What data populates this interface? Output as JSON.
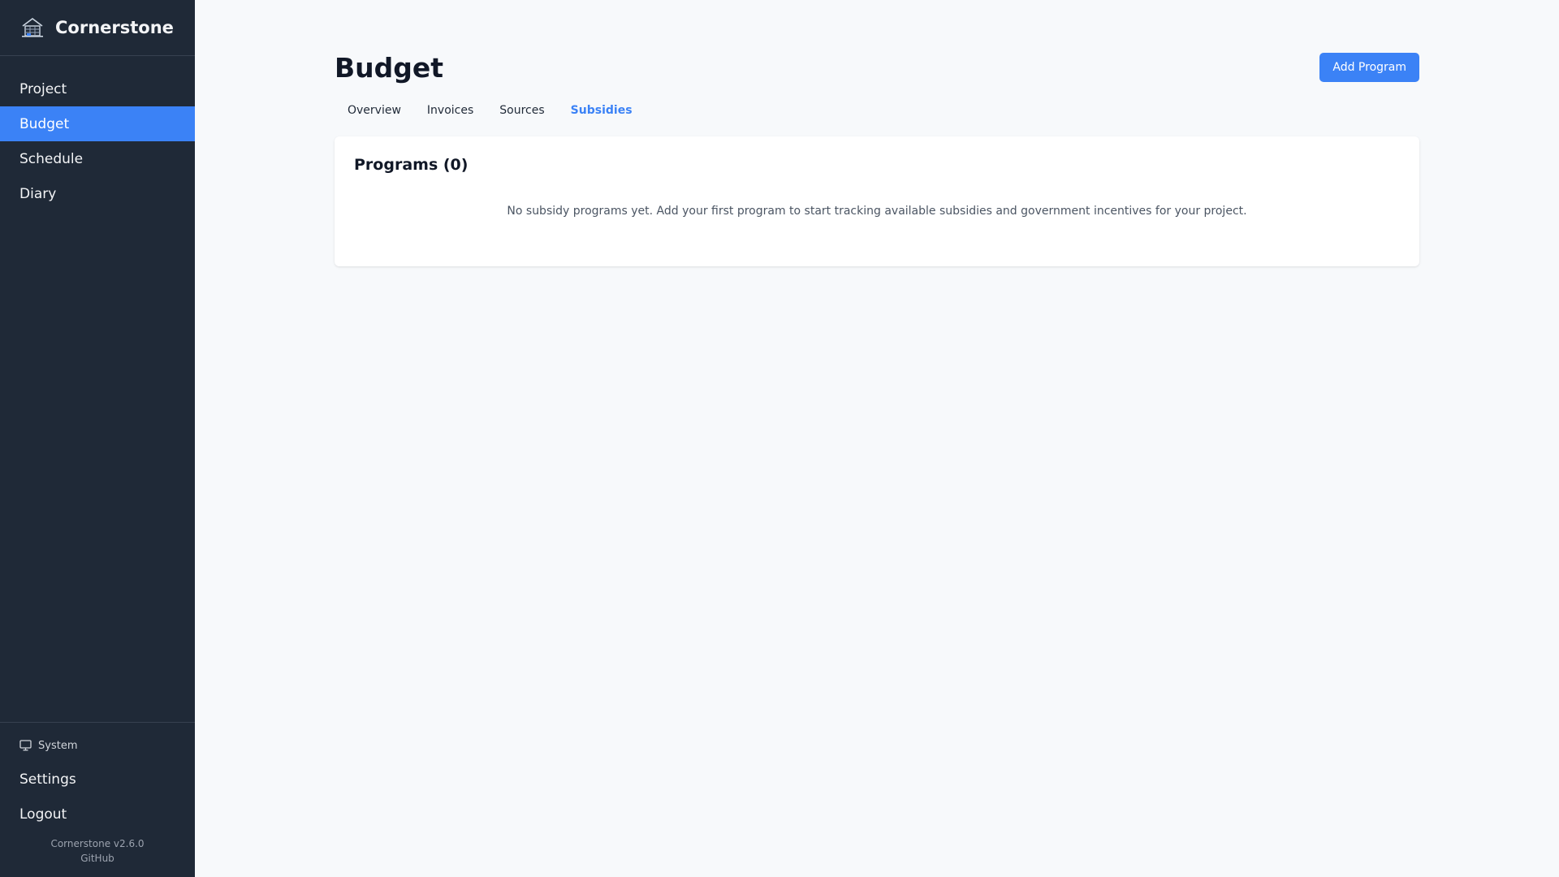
{
  "app": {
    "name": "Cornerstone",
    "logo_icon": "building-logo-icon"
  },
  "sidebar": {
    "items": [
      {
        "label": "Project",
        "active": false
      },
      {
        "label": "Budget",
        "active": true
      },
      {
        "label": "Schedule",
        "active": false
      },
      {
        "label": "Diary",
        "active": false
      }
    ],
    "theme_label": "System",
    "theme_icon": "monitor-icon",
    "settings_label": "Settings",
    "logout_label": "Logout",
    "version": "Cornerstone v2.6.0",
    "github_label": "GitHub"
  },
  "header": {
    "title": "Budget",
    "add_button_label": "Add Program"
  },
  "tabs": [
    {
      "label": "Overview",
      "active": false
    },
    {
      "label": "Invoices",
      "active": false
    },
    {
      "label": "Sources",
      "active": false
    },
    {
      "label": "Subsidies",
      "active": true
    }
  ],
  "programs": {
    "title": "Programs (0)",
    "empty_message": "No subsidy programs yet. Add your first program to start tracking available subsidies and government incentives for your project."
  },
  "colors": {
    "sidebar_bg": "#1f2937",
    "accent": "#3b82f6",
    "page_bg": "#f7f9fb"
  }
}
